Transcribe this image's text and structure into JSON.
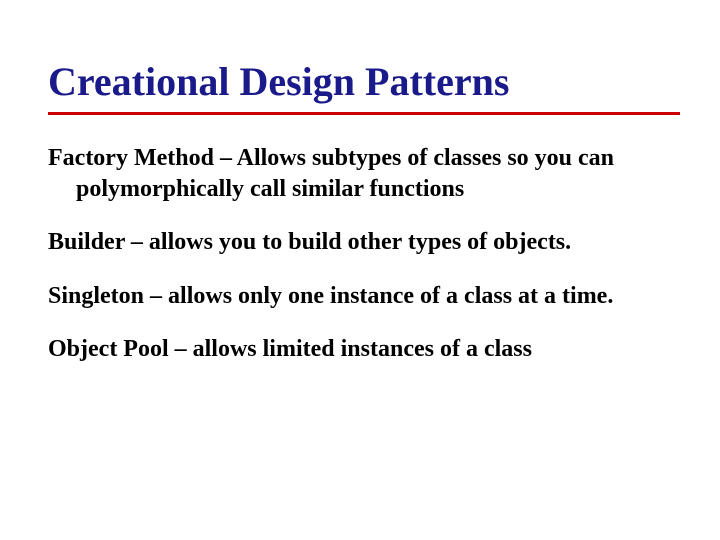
{
  "title": "Creational Design Patterns",
  "items": [
    "Factory Method – Allows subtypes of classes so you can polymorphically call similar functions",
    "Builder – allows you to build other types of objects.",
    "Singleton – allows only one instance of a class at a time.",
    "Object Pool – allows limited instances of a class"
  ]
}
